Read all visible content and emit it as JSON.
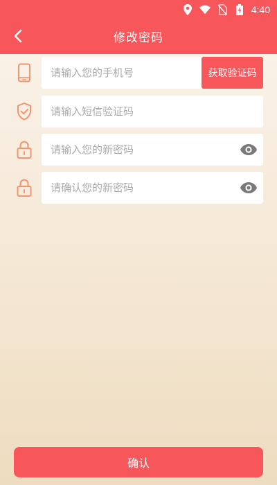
{
  "status_bar": {
    "time": "4:40",
    "icons": [
      "location-icon",
      "wifi-icon",
      "no-sim-icon",
      "battery-charging-icon"
    ]
  },
  "header": {
    "title": "修改密码",
    "back_icon": "chevron-left-icon"
  },
  "form": {
    "phone": {
      "icon": "phone-icon",
      "placeholder": "请输入您的手机号",
      "value": "",
      "button_label": "获取验证码"
    },
    "sms_code": {
      "icon": "shield-check-icon",
      "placeholder": "请输入短信验证码",
      "value": ""
    },
    "new_password": {
      "icon": "lock-icon",
      "placeholder": "请输入您的新密码",
      "value": "",
      "toggle_icon": "eye-icon"
    },
    "confirm_password": {
      "icon": "lock-icon",
      "placeholder": "请确认您的新密码",
      "value": "",
      "toggle_icon": "eye-icon"
    }
  },
  "confirm_label": "确认",
  "colors": {
    "accent": "#f7565a",
    "icon": "#f0956f",
    "eye": "#7a7a7a",
    "placeholder": "#a9a9a9"
  }
}
